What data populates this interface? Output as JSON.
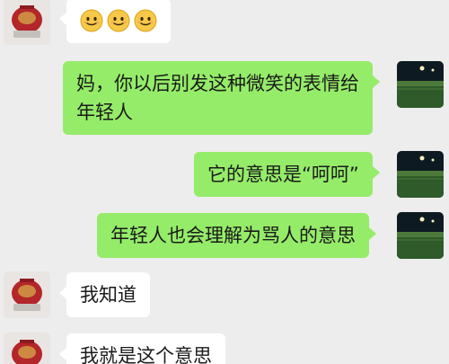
{
  "messages": [
    {
      "side": "left",
      "type": "emoji",
      "emoji_icon": "smile-emoji-icon",
      "emoji_count": 3
    },
    {
      "side": "right",
      "type": "text",
      "lines": [
        "妈，你以后别发这种微笑的表情给",
        "年轻人"
      ]
    },
    {
      "side": "right",
      "type": "text",
      "lines": [
        "它的意思是“呵呵”"
      ]
    },
    {
      "side": "right",
      "type": "text",
      "lines": [
        "年轻人也会理解为骂人的意思"
      ]
    },
    {
      "side": "left",
      "type": "text",
      "lines": [
        "我知道"
      ]
    },
    {
      "side": "left",
      "type": "text",
      "lines": [
        "我就是这个意思"
      ]
    }
  ],
  "avatars": {
    "mother": "vase-avatar-icon",
    "child": "night-field-avatar-icon"
  },
  "colors": {
    "background": "#ededed",
    "sent_bubble": "#95ec69",
    "received_bubble": "#ffffff"
  }
}
